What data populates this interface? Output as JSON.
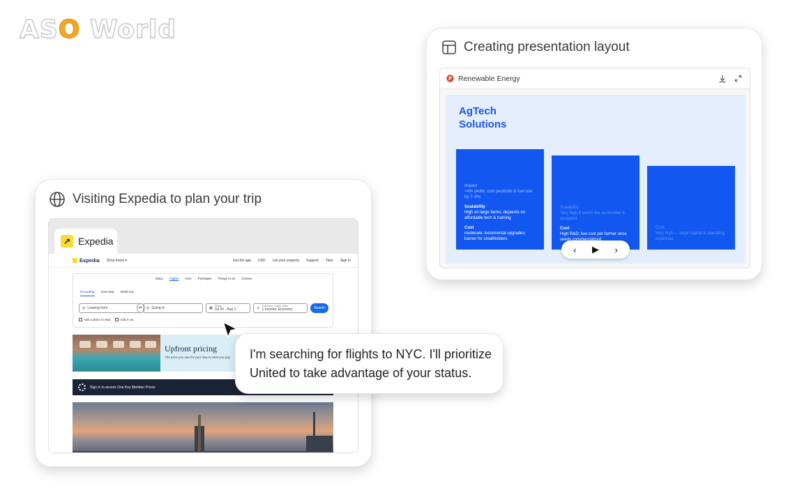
{
  "watermark": {
    "text_before": "AS",
    "text_o": "O",
    "text_after": " World"
  },
  "presentation_card": {
    "title": "Creating presentation layout",
    "file_name": "Renewable Energy",
    "slide": {
      "title": "AgTech Solutions",
      "columns": [
        {
          "impact_label": "Impact",
          "impact_text": "+4% yields; cuts pesticide & fuel use by 7–9%",
          "scalability_label": "Scalability",
          "scalability_text": "High on large farms; depends on affordable tech & training",
          "cost_label": "Cost",
          "cost_text": "moderate; incremental upgrades; barrier for smallholders"
        },
        {
          "scalability_label": "Scalability",
          "scalability_text": "Very high if seeds are accessible & accepted",
          "cost_label": "Cost",
          "cost_text": "High R&D; low cost per farmer once seeds commercialized"
        },
        {
          "cost_label": "Cost",
          "cost_text": "Very high — large capital & operating expenses"
        }
      ]
    },
    "controls": {
      "prev": "‹",
      "play": "▶",
      "next": "›"
    }
  },
  "expedia_card": {
    "title": "Visiting Expedia to plan your trip",
    "tab_label": "Expedia",
    "nav": {
      "brand": "Expedia",
      "shop": "Shop travel ▾",
      "links": [
        "Get the app",
        "USD",
        "List your property",
        "Support",
        "Trips",
        "Sign in"
      ]
    },
    "mode_tabs": [
      "Stays",
      "Flights",
      "Cars",
      "Packages",
      "Things to do",
      "Cruises"
    ],
    "active_mode": "Flights",
    "trip_types": [
      "Roundtrip",
      "One-way",
      "Multi-city"
    ],
    "fields": {
      "leaving": "Leaving from",
      "going": "Going to",
      "dates_label": "Dates",
      "dates_value": "Jul 25 - Aug 1",
      "travelers_label": "Travelers, Cabin class",
      "travelers_value": "1 traveler, Economy"
    },
    "search_button": "Search",
    "checkboxes": [
      "Add a place to stay",
      "Add a car"
    ],
    "promo": {
      "title": "Upfront pricing",
      "subtitle": "The price you see for your stay is what you pay"
    },
    "member_banner": "Sign in to access One Key Member Prices"
  },
  "bubble_text": "I'm searching for flights to NYC. I'll prioritize United to take advantage of your status.",
  "colors": {
    "accent_blue": "#1257f0",
    "slide_bg": "#e4eefd",
    "expedia_yellow": "#fddb32",
    "search_blue": "#1a6ae8"
  }
}
